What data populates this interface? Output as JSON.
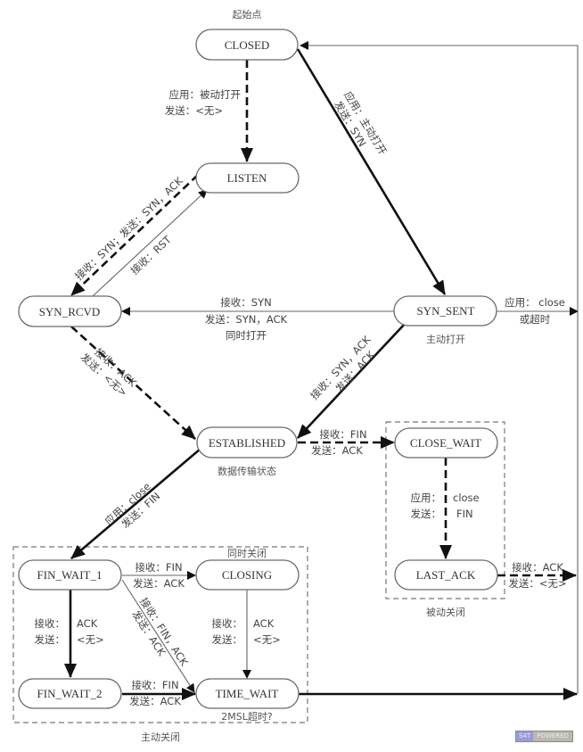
{
  "diagram": {
    "title_note": "起始点",
    "states": {
      "closed": "CLOSED",
      "listen": "LISTEN",
      "syn_rcvd": "SYN_RCVD",
      "syn_sent": "SYN_SENT",
      "established": "ESTABLISHED",
      "close_wait": "CLOSE_WAIT",
      "last_ack": "LAST_ACK",
      "fin_wait_1": "FIN_WAIT_1",
      "closing": "CLOSING",
      "fin_wait_2": "FIN_WAIT_2",
      "time_wait": "TIME_WAIT"
    },
    "notes": {
      "syn_sent": "主动打开",
      "established": "数据传输状态",
      "simultaneous_close": "同时关闭",
      "time_wait": "2MSL超时?",
      "passive_close": "被动关闭",
      "active_close": "主动关闭"
    },
    "transitions": {
      "closed_listen": [
        "应用：被动打开",
        "发送：<无>"
      ],
      "closed_syn_sent": [
        "应用：主动打开",
        "发送：SYN"
      ],
      "listen_syn_rcvd": [
        "接收：SYN；发送：SYN，ACK"
      ],
      "syn_rcvd_listen": [
        "接收：RST"
      ],
      "syn_sent_syn_rcvd": [
        "接收：SYN",
        "发送：SYN，ACK",
        "同时打开"
      ],
      "syn_sent_closed": [
        "应用：  close",
        "或超时"
      ],
      "syn_rcvd_established": [
        "接收：ACK",
        "发送：<无>"
      ],
      "syn_sent_established": [
        "接收：SYN，ACK",
        "发送：ACK"
      ],
      "established_close_wait": [
        "接收：FIN",
        "发送：ACK"
      ],
      "close_wait_last_ack": [
        "应用：",
        "close",
        "发送：",
        "FIN"
      ],
      "last_ack_closed": [
        "接收：ACK",
        "发送：<无>"
      ],
      "established_fin_wait_1": [
        "应用：close",
        "发送：FIN"
      ],
      "fin_wait_1_closing": [
        "接收：FIN",
        "发送：ACK"
      ],
      "fin_wait_1_fin_wait_2": [
        "接收：",
        "ACK",
        "发送：",
        "<无>"
      ],
      "fin_wait_1_time_wait": [
        "接收：FIN，ACK",
        "发送：ACK"
      ],
      "closing_time_wait": [
        "接收：",
        "ACK",
        "发送：",
        "<无>"
      ],
      "fin_wait_2_time_wait": [
        "接收：FIN",
        "发送：ACK"
      ]
    },
    "badge": [
      "S4T",
      "POWERED"
    ]
  }
}
